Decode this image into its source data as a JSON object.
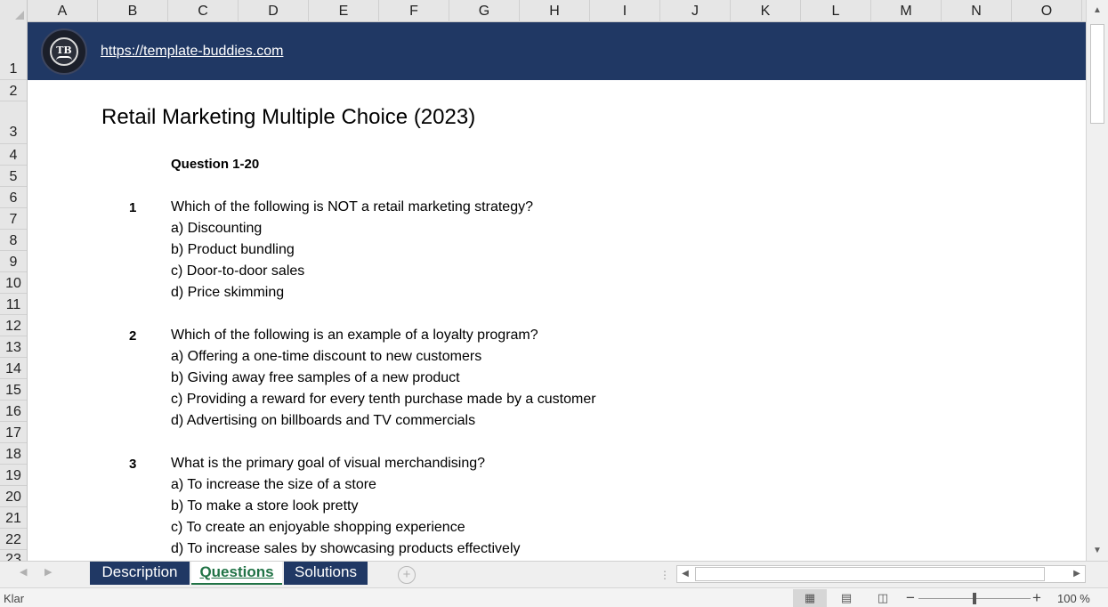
{
  "columns": [
    "A",
    "B",
    "C",
    "D",
    "E",
    "F",
    "G",
    "H",
    "I",
    "J",
    "K",
    "L",
    "M",
    "N",
    "O"
  ],
  "rows": [
    "1",
    "2",
    "3",
    "4",
    "5",
    "6",
    "7",
    "8",
    "9",
    "10",
    "11",
    "12",
    "13",
    "14",
    "15",
    "16",
    "17",
    "18",
    "19",
    "20",
    "21",
    "22",
    "23"
  ],
  "banner": {
    "logo_text": "TB",
    "url": "https://template-buddies.com"
  },
  "title": "Retail Marketing Multiple Choice (2023)",
  "section_header": "Question 1-20",
  "questions": [
    {
      "number": "1",
      "text": "Which of the following is NOT a retail marketing strategy?",
      "options": [
        "a) Discounting",
        "b) Product bundling",
        "c) Door-to-door sales",
        "d) Price skimming"
      ]
    },
    {
      "number": "2",
      "text": "Which of the following is an example of a loyalty program?",
      "options": [
        "a) Offering a one-time discount to new customers",
        "b) Giving away free samples of a new product",
        "c) Providing a reward for every tenth purchase made by a customer",
        "d) Advertising on billboards and TV commercials"
      ]
    },
    {
      "number": "3",
      "text": "What is the primary goal of visual merchandising?",
      "options": [
        "a) To increase the size of a store",
        "b) To make a store look pretty",
        "c) To create an enjoyable shopping experience",
        "d) To increase sales by showcasing products effectively"
      ]
    }
  ],
  "tabs": [
    {
      "label": "Description",
      "active": false
    },
    {
      "label": "Questions",
      "active": true
    },
    {
      "label": "Solutions",
      "active": false
    }
  ],
  "status": {
    "ready_text": "Klar",
    "zoom_level": "100 %",
    "zoom_percent": 100
  },
  "colors": {
    "banner": "#203864",
    "active_tab_text": "#217346",
    "header_bg": "#e6e6e6"
  },
  "icons": [
    "add-sheet-icon",
    "normal-view-icon",
    "page-layout-icon",
    "page-break-icon",
    "zoom-out-icon",
    "zoom-in-icon",
    "scroll-up-icon",
    "scroll-down-icon",
    "scroll-left-icon",
    "scroll-right-icon"
  ]
}
